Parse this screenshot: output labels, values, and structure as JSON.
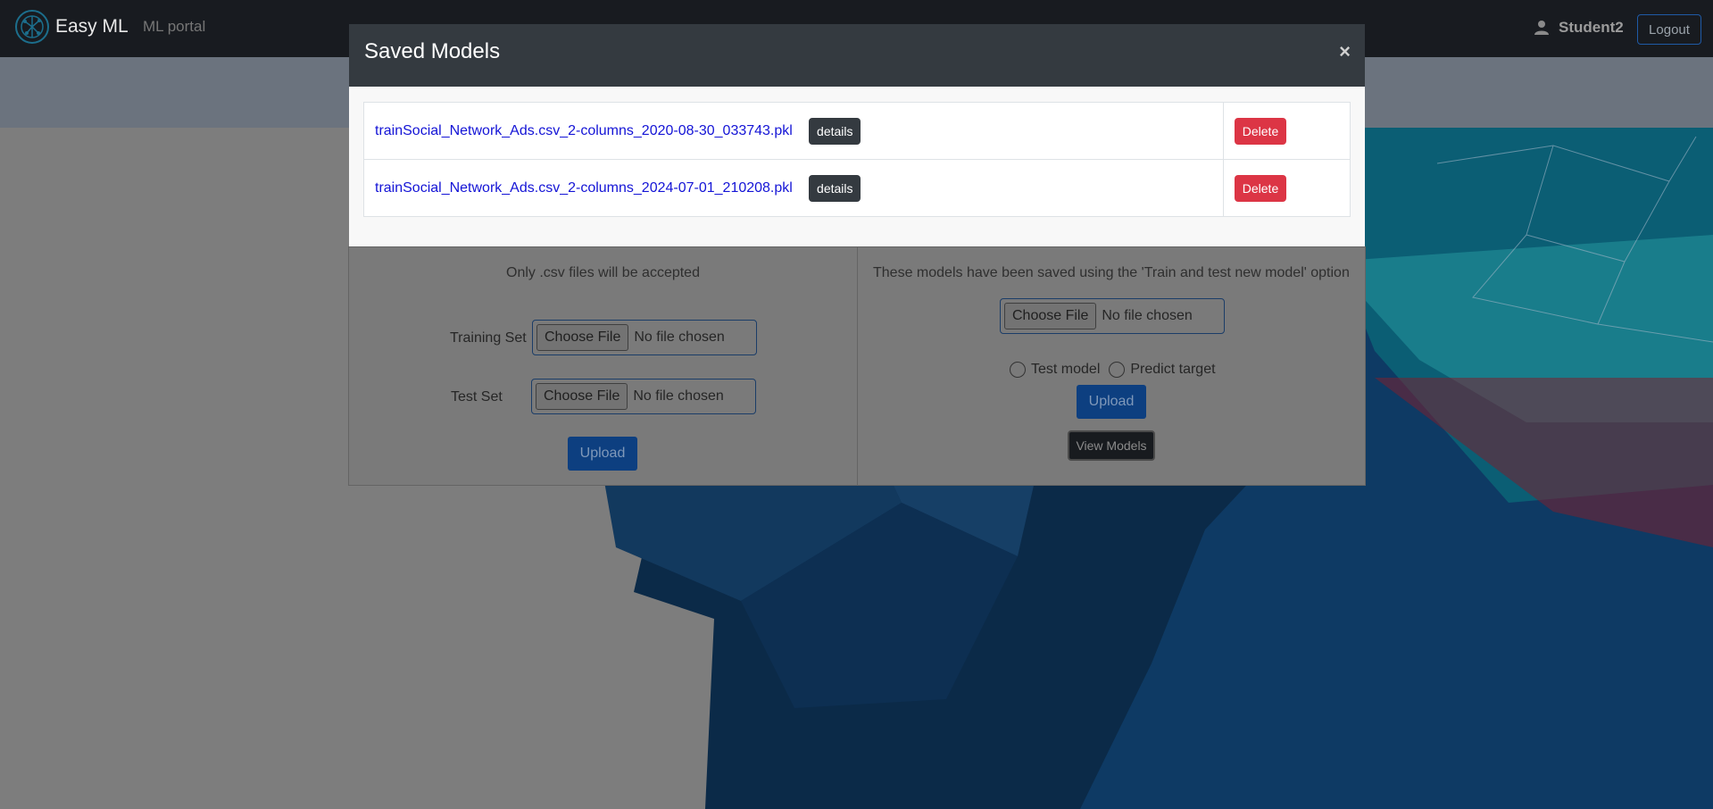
{
  "navbar": {
    "brand": "Easy ML",
    "nav_link": "ML portal",
    "user_name": "Student2",
    "logout_label": "Logout"
  },
  "train_panel": {
    "hint": "Only .csv files will be accepted",
    "training_set_label": "Training Set",
    "test_set_label": "Test Set",
    "choose_file_label": "Choose File",
    "no_file_text": "No file chosen",
    "upload_label": "Upload"
  },
  "saved_panel": {
    "hint": "These models have been saved using the 'Train and test new model' option",
    "choose_file_label": "Choose File",
    "no_file_text": "No file chosen",
    "radio_test_label": "Test model",
    "radio_predict_label": "Predict target",
    "upload_label": "Upload",
    "view_models_label": "View Models"
  },
  "modal": {
    "title": "Saved Models",
    "close_symbol": "×",
    "models": [
      {
        "name": "trainSocial_Network_Ads.csv_2-columns_2020-08-30_033743.pkl",
        "details_label": "details",
        "delete_label": "Delete"
      },
      {
        "name": "trainSocial_Network_Ads.csv_2-columns_2024-07-01_210208.pkl",
        "details_label": "details",
        "delete_label": "Delete"
      }
    ]
  },
  "colors": {
    "navbar_bg": "#181b20",
    "modal_header_bg": "#343a40",
    "delete_red": "#dc3545",
    "primary_blue": "#007bff",
    "link_blue": "#1414d6"
  }
}
